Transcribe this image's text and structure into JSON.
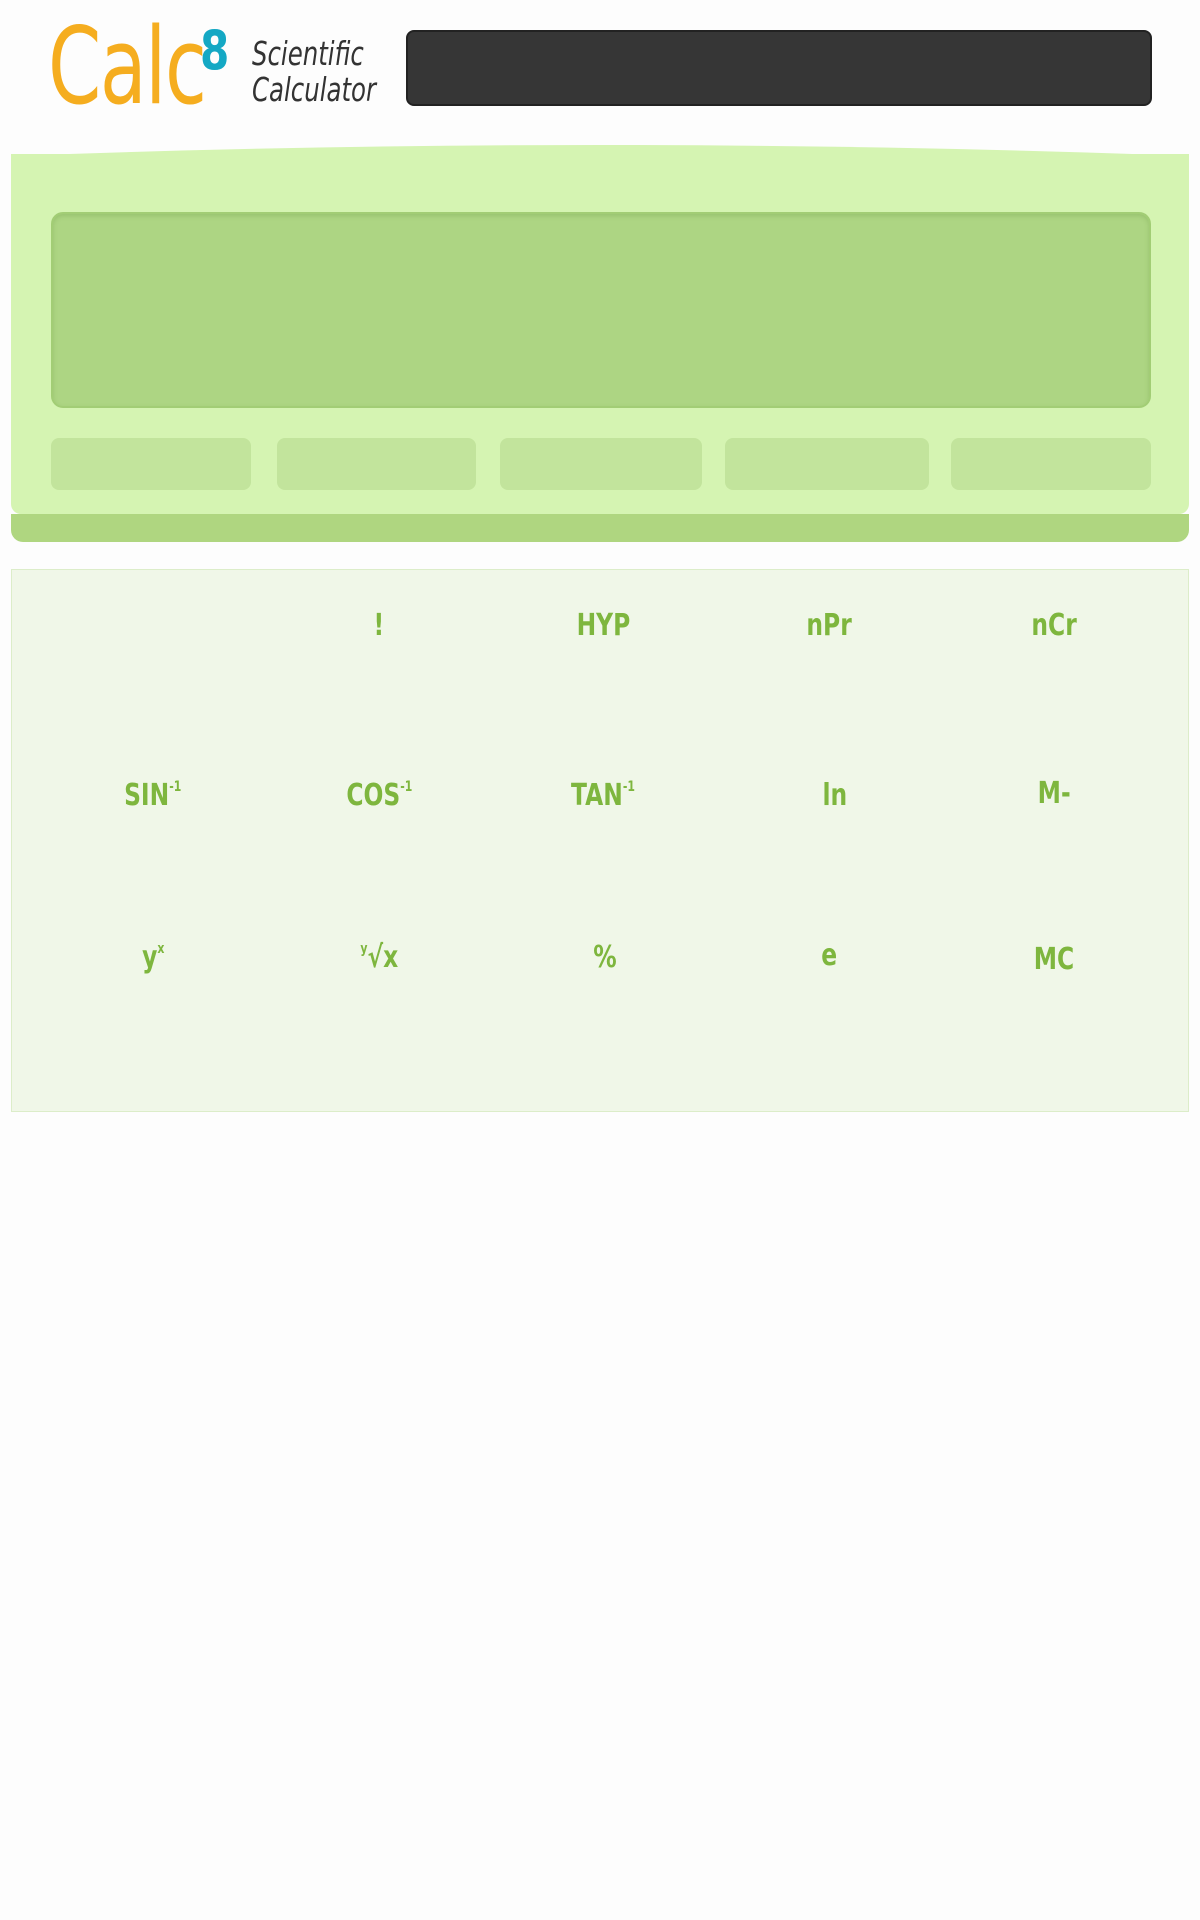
{
  "header": {
    "logo_word": "Calc",
    "logo_superscript": "8",
    "logo_subtitle_line1": "Scientific",
    "logo_subtitle_line2": "Calculator"
  },
  "display": {
    "value": ""
  },
  "memory_keys": [
    "",
    "",
    "",
    "",
    ""
  ],
  "keypad": {
    "rows": [
      [
        {
          "id": "blank",
          "label": "",
          "sup": ""
        },
        {
          "id": "factorial",
          "label": "!",
          "sup": ""
        },
        {
          "id": "hyp",
          "label": "HYP",
          "sup": ""
        },
        {
          "id": "npr",
          "label": "nPr",
          "sup": ""
        },
        {
          "id": "ncr",
          "label": "nCr",
          "sup": ""
        }
      ],
      [
        {
          "id": "asin",
          "label": "SIN",
          "sup": "-1"
        },
        {
          "id": "acos",
          "label": "COS",
          "sup": "-1"
        },
        {
          "id": "atan",
          "label": "TAN",
          "sup": "-1"
        },
        {
          "id": "ln",
          "label": "ln",
          "sup": ""
        },
        {
          "id": "m-minus",
          "label": "M-",
          "sup": ""
        }
      ],
      [
        {
          "id": "power",
          "label": "y",
          "sup": "x"
        },
        {
          "id": "root",
          "label": "√x",
          "pre": "y"
        },
        {
          "id": "percent",
          "label": "%",
          "sup": ""
        },
        {
          "id": "euler",
          "label": "e",
          "sup": ""
        },
        {
          "id": "mc",
          "label": "MC",
          "sup": ""
        }
      ]
    ]
  },
  "colors": {
    "logo_orange": "#f5ad1f",
    "logo_teal": "#14a8c4",
    "calc_body": "#d5f4b2",
    "display": "#add583",
    "key_text": "#7eb63e"
  }
}
